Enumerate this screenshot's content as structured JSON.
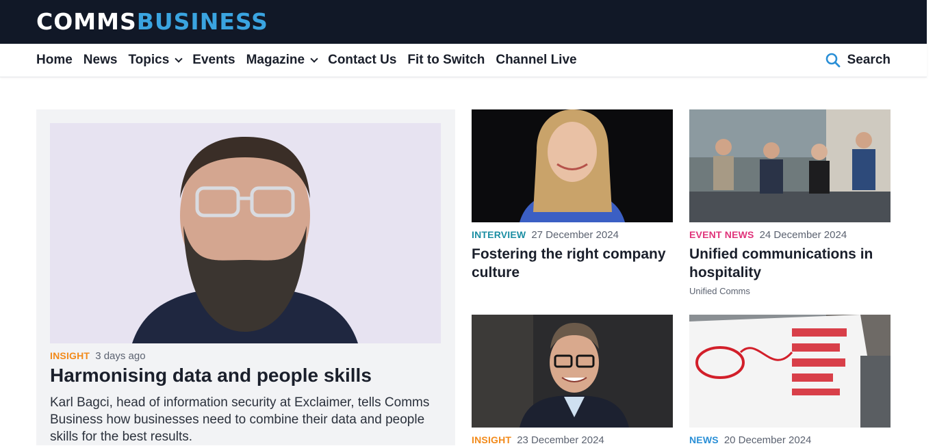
{
  "header": {
    "logo_part1": "COMMS",
    "logo_part2": "BUSINESS",
    "brand_color": "#3aa4e0",
    "bar_color": "#111827"
  },
  "nav": {
    "items": [
      {
        "label": "Home",
        "has_dropdown": false
      },
      {
        "label": "News",
        "has_dropdown": false
      },
      {
        "label": "Topics",
        "has_dropdown": true
      },
      {
        "label": "Events",
        "has_dropdown": false
      },
      {
        "label": "Magazine",
        "has_dropdown": true
      },
      {
        "label": "Contact Us",
        "has_dropdown": false
      },
      {
        "label": "Fit to Switch",
        "has_dropdown": false
      },
      {
        "label": "Channel Live",
        "has_dropdown": false
      }
    ],
    "search_label": "Search",
    "search_icon": "magnifier-icon"
  },
  "feature": {
    "category": "INSIGHT",
    "category_color": "#f28a1a",
    "date": "3 days ago",
    "title": "Harmonising data and people skills",
    "excerpt": "Karl Bagci, head of information security at Exclaimer, tells Comms Business how businesses need to combine their data and people skills for the best results."
  },
  "cards": [
    {
      "category": "INTERVIEW",
      "category_color": "#1b8ea3",
      "date": "27 December 2024",
      "title": "Fostering the right company culture",
      "tag": ""
    },
    {
      "category": "EVENT NEWS",
      "category_color": "#e0337a",
      "date": "24 December 2024",
      "title": "Unified communications in hospitality",
      "tag": "Unified Comms"
    },
    {
      "category": "INSIGHT",
      "category_color": "#f28a1a",
      "date": "23 December 2024",
      "title": "",
      "tag": ""
    },
    {
      "category": "NEWS",
      "category_color": "#2a8fd6",
      "date": "20 December 2024",
      "title": "",
      "tag": ""
    }
  ]
}
